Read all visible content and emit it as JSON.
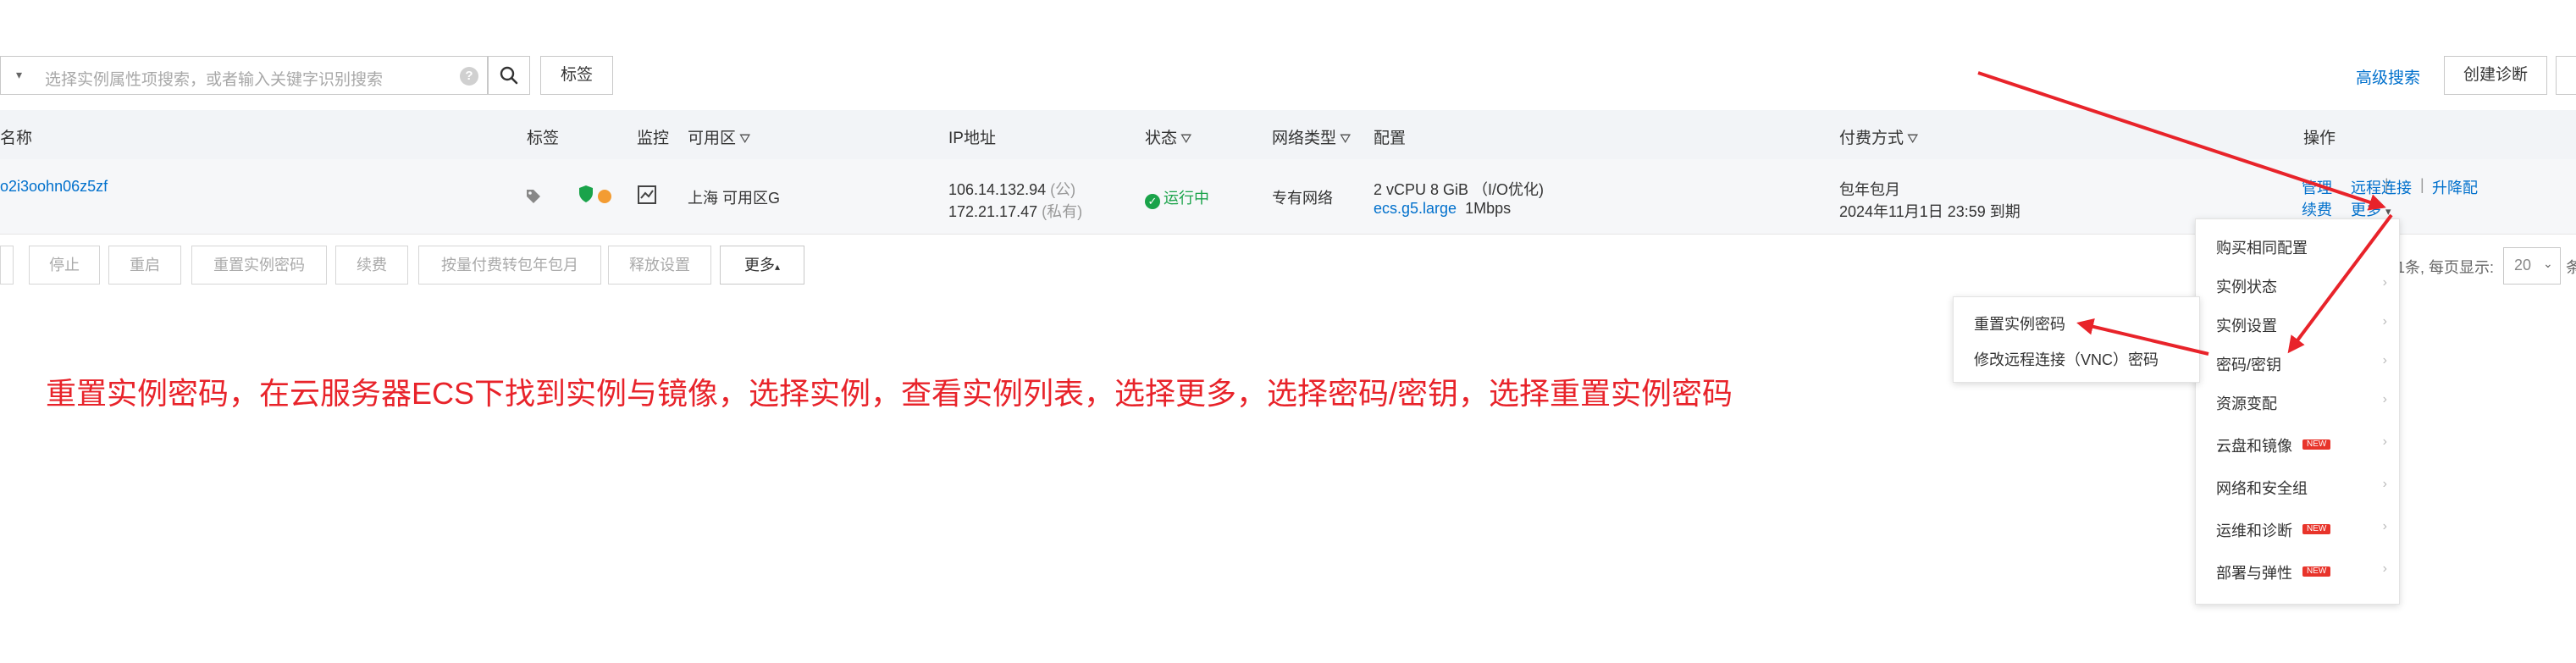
{
  "toolbar": {
    "search_placeholder": "选择实例属性项搜索，或者输入关键字识别搜索",
    "help_symbol": "?",
    "tag_label": "标签",
    "advanced_search": "高级搜索",
    "create_diagnosis": "创建诊断"
  },
  "table": {
    "headers": {
      "name": "名称",
      "tag": "标签",
      "monitor": "监控",
      "zone": "可用区",
      "ip": "IP地址",
      "status": "状态",
      "network": "网络类型",
      "config": "配置",
      "billing": "付费方式",
      "ops": "操作"
    },
    "row": {
      "id": "o2i3oohn06z5zf",
      "zone": "上海 可用区G",
      "ip_public": "106.14.132.94",
      "ip_public_tag": "(公)",
      "ip_private": "172.21.17.47",
      "ip_private_tag": "(私有)",
      "status": "运行中",
      "network": "专有网络",
      "config_line1": "2 vCPU 8 GiB （I/O优化)",
      "config_type": "ecs.g5.large",
      "config_bandwidth": "1Mbps",
      "billing_type": "包年包月",
      "billing_expire": "2024年11月1日 23:59 到期",
      "ops": {
        "manage": "管理",
        "remote": "远程连接",
        "upgrade": "升降配",
        "renew": "续费",
        "more": "更多"
      }
    }
  },
  "actions": {
    "stop": "停止",
    "restart": "重启",
    "reset_password": "重置实例密码",
    "renew": "续费",
    "convert": "按量付费转包年包月",
    "release": "释放设置",
    "more": "更多"
  },
  "pager": {
    "text": "1条, 每页显示:",
    "page_size": "20",
    "tail": "条"
  },
  "more_menu": [
    {
      "label": "购买相同配置",
      "submenu": false,
      "badge": ""
    },
    {
      "label": "实例状态",
      "submenu": true,
      "badge": ""
    },
    {
      "label": "实例设置",
      "submenu": true,
      "badge": ""
    },
    {
      "label": "密码/密钥",
      "submenu": true,
      "badge": ""
    },
    {
      "label": "资源变配",
      "submenu": true,
      "badge": ""
    },
    {
      "label": "云盘和镜像",
      "submenu": true,
      "badge": "NEW"
    },
    {
      "label": "网络和安全组",
      "submenu": true,
      "badge": ""
    },
    {
      "label": "运维和诊断",
      "submenu": true,
      "badge": "NEW"
    },
    {
      "label": "部署与弹性",
      "submenu": true,
      "badge": "NEW"
    }
  ],
  "submenu": {
    "reset_password": "重置实例密码",
    "modify_vnc": "修改远程连接（VNC）密码"
  },
  "annotation": "重置实例密码，在云服务器ECS下找到实例与镜像，选择实例，查看实例列表，选择更多，选择密码/密钥，选择重置实例密码",
  "colors": {
    "link": "#0070cc",
    "annotation": "#e8232a",
    "status_running": "#1aa34a",
    "badge_new": "#e8342b"
  }
}
